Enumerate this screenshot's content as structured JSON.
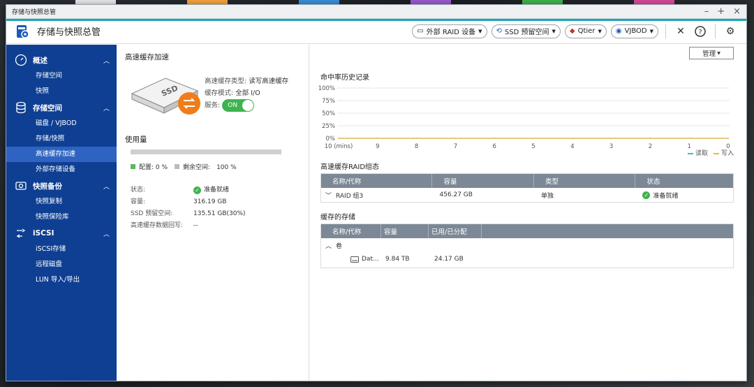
{
  "window": {
    "title": "存储与快照总管"
  },
  "app": {
    "title": "存储与快照总管"
  },
  "toolbar": {
    "external_raid": "外部 RAID 设备",
    "ssd_overprovision": "SSD 预留空间",
    "qtier": "Qtier",
    "vjbod": "VJBOD"
  },
  "sidebar": {
    "groups": [
      {
        "label": "概述",
        "items": [
          "存储空间",
          "快照"
        ]
      },
      {
        "label": "存储空间",
        "items": [
          "磁盘 / VJBOD",
          "存储/快照",
          "高速缓存加速",
          "外部存储设备"
        ]
      },
      {
        "label": "快照备份",
        "items": [
          "快照复制",
          "快照保险库"
        ]
      },
      {
        "label": "iSCSI",
        "items": [
          "iSCSI存储",
          "远程磁盘",
          "LUN 导入/导出"
        ]
      }
    ],
    "active_item": "高速缓存加速"
  },
  "cache": {
    "title": "高速缓存加速",
    "ssd_label": "SSD",
    "type_label": "高速缓存类型:",
    "type_value": "读写高速缓存",
    "mode_label": "缓存模式:",
    "mode_value": "全部 I/O",
    "service_label": "服务:",
    "service_value": "ON",
    "usage_title": "使用量",
    "usage_fraction": 0.0,
    "legend_allocated": "配置: 0 %",
    "legend_free": "剩余空间:　100 %",
    "status_label": "状态:",
    "status_value": "准备就绪",
    "capacity_label": "容量:",
    "capacity_value": "316.19 GB",
    "ssd_reserve_label": "SSD 预留空间:",
    "ssd_reserve_value": "135.51 GB(30%)",
    "recovery_label": "高速缓存数据回写:",
    "recovery_value": "--"
  },
  "manage_label": "管理",
  "chart_data": {
    "type": "line",
    "title": "命中率历史记录",
    "x": [
      "10 (mins)",
      "9",
      "8",
      "7",
      "6",
      "5",
      "4",
      "3",
      "2",
      "1",
      "0"
    ],
    "yticks": [
      "100%",
      "75%",
      "50%",
      "25%",
      "0%"
    ],
    "ylim": [
      0,
      100
    ],
    "grid": true,
    "legend_position": "bottom-right",
    "series": [
      {
        "name": "读取",
        "color": "#3bb7d6",
        "values": [
          0,
          0,
          0,
          0,
          0,
          0,
          0,
          0,
          0,
          0,
          0
        ]
      },
      {
        "name": "写入",
        "color": "#f2b63c",
        "values": [
          0,
          0,
          0,
          0,
          0,
          0,
          0,
          0,
          0,
          0,
          0
        ]
      }
    ]
  },
  "raid_table": {
    "title": "高速缓存RAID组态",
    "headers": [
      "名称/代称",
      "容量",
      "类型",
      "状态"
    ],
    "rows": [
      {
        "name": "RAID 组3",
        "capacity": "456.27 GB",
        "type": "单独",
        "status": "准备就绪"
      }
    ]
  },
  "cached_table": {
    "title": "缓存的存储",
    "headers": [
      "名称/代称",
      "容量",
      "已用/已分配"
    ],
    "group": "卷",
    "rows": [
      {
        "name": "Dat...",
        "capacity": "9.84 TB",
        "used": "24.17 GB"
      }
    ]
  }
}
